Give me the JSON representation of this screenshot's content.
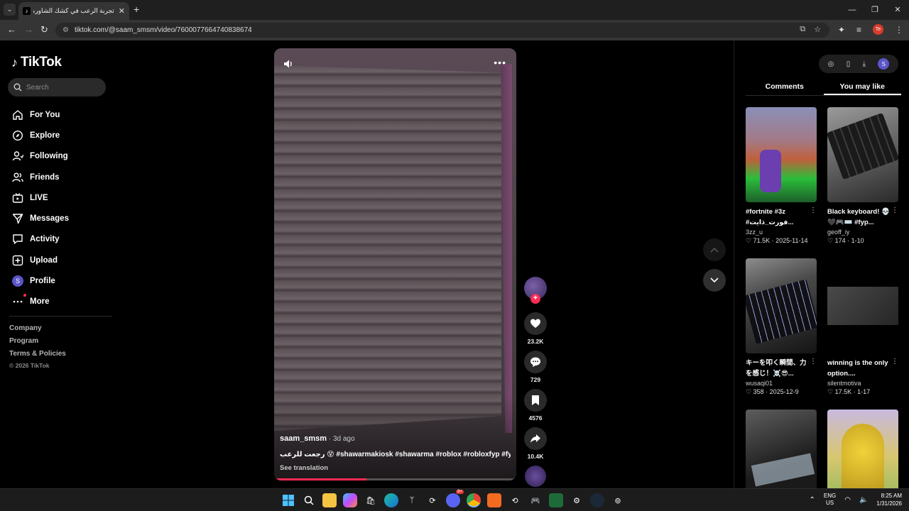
{
  "browser": {
    "tab_title": "تجربة الرعب في كشك الشاورما | k",
    "tab_favicon": "tiktok-icon",
    "url": "tiktok.com/@saam_smsm/video/7600077664740838674",
    "profile_initial": "Te"
  },
  "sidebar": {
    "logo": "TikTok",
    "search_placeholder": "Search",
    "nav": [
      {
        "label": "For You",
        "icon": "home-icon"
      },
      {
        "label": "Explore",
        "icon": "compass-icon"
      },
      {
        "label": "Following",
        "icon": "following-icon"
      },
      {
        "label": "Friends",
        "icon": "friends-icon"
      },
      {
        "label": "LIVE",
        "icon": "live-icon"
      },
      {
        "label": "Messages",
        "icon": "messages-icon"
      },
      {
        "label": "Activity",
        "icon": "activity-icon"
      },
      {
        "label": "Upload",
        "icon": "upload-icon"
      },
      {
        "label": "Profile",
        "icon": "profile-avatar",
        "initial": "S"
      },
      {
        "label": "More",
        "icon": "more-icon"
      }
    ],
    "footer_links": [
      "Company",
      "Program",
      "Terms & Policies"
    ],
    "copyright": "© 2026 TikTok"
  },
  "video": {
    "author": "saam_smsm",
    "time": " · 3d ago",
    "caption": "رجعت للرعب 😵 #shawarmakiosk #shawarma #roblox #robloxfyp #fyp ...",
    "see_translation": "See translation",
    "progress": 0.38
  },
  "actions": {
    "likes": "23.2K",
    "comments": "729",
    "saves": "4576",
    "shares": "10.4K"
  },
  "right_panel": {
    "user_initial": "S",
    "tabs": [
      {
        "label": "Comments",
        "active": false
      },
      {
        "label": "You may like",
        "active": true
      }
    ],
    "cards": [
      {
        "title": "#fortnite #3z #فورت_ذايت...",
        "user": "3zz_u",
        "likes": "71.5K",
        "date": "2025-11-14"
      },
      {
        "title": "Black keyboard! 💀🖤🎮⌨️ #fyp...",
        "user": "geoff_iy",
        "likes": "174",
        "date": "1-10"
      },
      {
        "title": "キーを叩く瞬間、力を感じ！☠️😎...",
        "user": "wusaqi01",
        "likes": "358",
        "date": "2025-12-9"
      },
      {
        "title": "winning is the only option....",
        "user": "silentmotiva",
        "likes": "17.5K",
        "date": "1-17"
      },
      {
        "title": "",
        "user": "",
        "likes": "",
        "date": ""
      },
      {
        "title": "",
        "user": "",
        "likes": "",
        "date": ""
      }
    ]
  },
  "taskbar": {
    "lang_top": "ENG",
    "lang_bottom": "US",
    "time": "8:25 AM",
    "date": "1/31/2026",
    "discord_badge": "9+"
  },
  "colors": {
    "accent": "#fe2c55",
    "bg": "#000000",
    "panel": "#1f1f1f"
  }
}
